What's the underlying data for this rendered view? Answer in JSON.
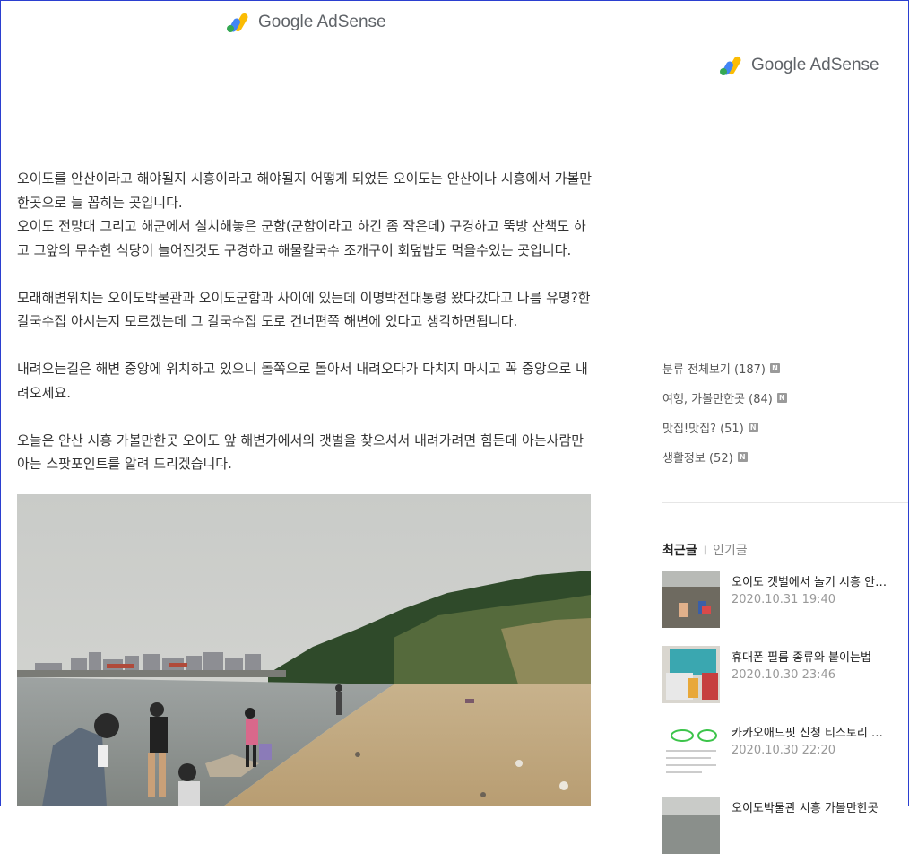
{
  "ads": {
    "top_label": "Google AdSense",
    "side_label": "Google AdSense"
  },
  "post": {
    "paragraphs": [
      "오이도를 안산이라고 해야될지 시흥이라고 해야될지 어떻게 되었든 오이도는 안산이나 시흥에서 가볼만한곳으로 늘 꼽히는 곳입니다.\n오이도 전망대 그리고 해군에서 설치해놓은 군함(군함이라고 하긴 좀 작은데) 구경하고 뚝방 산책도 하고 그앞의 무수한 식당이 늘어진것도 구경하고 해물칼국수 조개구이 회덮밥도 먹을수있는 곳입니다.",
      "모래해변위치는 오이도박물관과 오이도군함과 사이에 있는데 이명박전대통령 왔다갔다고 나름 유명?한 칼국수집 아시는지 모르겠는데 그 칼국수집 도로 건너편쪽 해변에 있다고 생각하면됩니다.",
      "내려오는길은 해변 중앙에 위치하고 있으니 돌쪽으로 돌아서 내려오다가 다치지 마시고 꼭 중앙으로 내려오세요.",
      "오늘은 안산 시흥 가볼만한곳 오이도 앞 해변가에서의 갯벌을 찾으셔서 내려가려면 힘든데 아는사람만 아는 스팟포인트를 알려 드리겠습니다."
    ]
  },
  "sidebar": {
    "categories": [
      {
        "label": "분류 전체보기 (187)",
        "badge": "N"
      },
      {
        "label": "여행, 가볼만한곳 (84)",
        "badge": "N"
      },
      {
        "label": "맛집!맛집? (51)",
        "badge": "N"
      },
      {
        "label": "생활정보 (52)",
        "badge": "N"
      }
    ],
    "tabs": {
      "recent": "최근글",
      "separator": "|",
      "popular": "인기글"
    },
    "recent_posts": [
      {
        "title": "오이도 갯벌에서 놀기 시흥 안산 가볼만한곳",
        "date": "2020.10.31 19:40"
      },
      {
        "title": "휴대폰 필름 종류와 붙이는법",
        "date": "2020.10.30 23:46"
      },
      {
        "title": "카카오애드핏 신청 티스토리 광고 게재 방법",
        "date": "2020.10.30 22:20"
      },
      {
        "title": "오이도박물관 시흥 가볼만한곳",
        "date": ""
      }
    ]
  },
  "colors": {
    "accent_border": "#2b3fd0",
    "badge_gray": "#9a9a9a"
  }
}
